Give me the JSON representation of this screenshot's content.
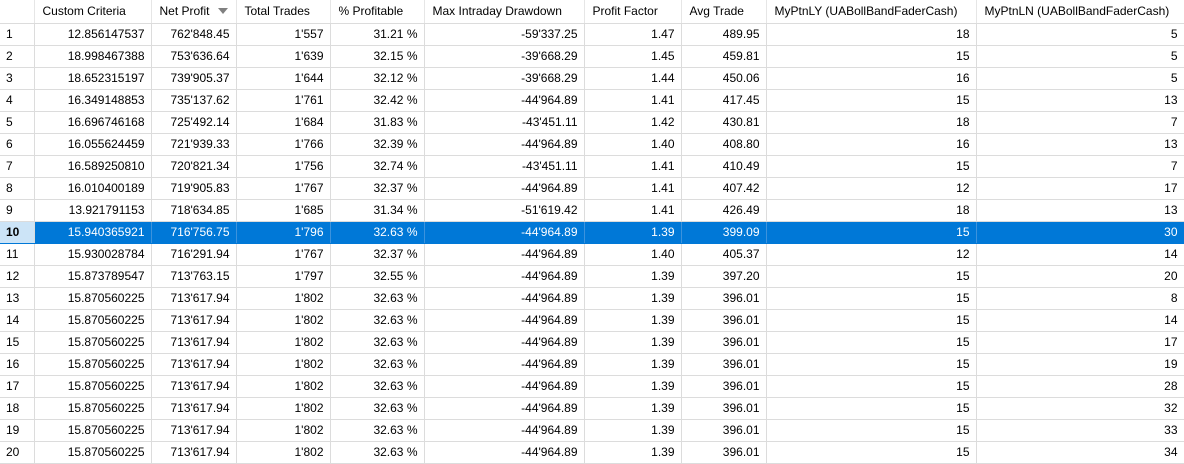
{
  "columns": [
    {
      "key": "idx",
      "label": ""
    },
    {
      "key": "custom",
      "label": "Custom Criteria"
    },
    {
      "key": "net",
      "label": "Net Profit"
    },
    {
      "key": "trades",
      "label": "Total Trades"
    },
    {
      "key": "pct",
      "label": "% Profitable"
    },
    {
      "key": "dd",
      "label": "Max Intraday Drawdown"
    },
    {
      "key": "pf",
      "label": "Profit Factor"
    },
    {
      "key": "avg",
      "label": "Avg Trade"
    },
    {
      "key": "ly",
      "label": "MyPtnLY (UABollBandFaderCash)"
    },
    {
      "key": "ln",
      "label": "MyPtnLN (UABollBandFaderCash)"
    }
  ],
  "sort": {
    "column": "net",
    "direction": "desc",
    "icon": "sort-descending-icon"
  },
  "selected_row": 10,
  "colors": {
    "selection": "#0078d7",
    "selection_index": "#cce4f7",
    "grid_line": "#dcdcdc"
  },
  "rows": [
    [
      "1",
      "12.856147537",
      "762'848.45",
      "1'557",
      "31.21 %",
      "-59'337.25",
      "1.47",
      "489.95",
      "18",
      "5"
    ],
    [
      "2",
      "18.998467388",
      "753'636.64",
      "1'639",
      "32.15 %",
      "-39'668.29",
      "1.45",
      "459.81",
      "15",
      "5"
    ],
    [
      "3",
      "18.652315197",
      "739'905.37",
      "1'644",
      "32.12 %",
      "-39'668.29",
      "1.44",
      "450.06",
      "16",
      "5"
    ],
    [
      "4",
      "16.349148853",
      "735'137.62",
      "1'761",
      "32.42 %",
      "-44'964.89",
      "1.41",
      "417.45",
      "15",
      "13"
    ],
    [
      "5",
      "16.696746168",
      "725'492.14",
      "1'684",
      "31.83 %",
      "-43'451.11",
      "1.42",
      "430.81",
      "18",
      "7"
    ],
    [
      "6",
      "16.055624459",
      "721'939.33",
      "1'766",
      "32.39 %",
      "-44'964.89",
      "1.40",
      "408.80",
      "16",
      "13"
    ],
    [
      "7",
      "16.589250810",
      "720'821.34",
      "1'756",
      "32.74 %",
      "-43'451.11",
      "1.41",
      "410.49",
      "15",
      "7"
    ],
    [
      "8",
      "16.010400189",
      "719'905.83",
      "1'767",
      "32.37 %",
      "-44'964.89",
      "1.41",
      "407.42",
      "12",
      "17"
    ],
    [
      "9",
      "13.921791153",
      "718'634.85",
      "1'685",
      "31.34 %",
      "-51'619.42",
      "1.41",
      "426.49",
      "18",
      "13"
    ],
    [
      "10",
      "15.940365921",
      "716'756.75",
      "1'796",
      "32.63 %",
      "-44'964.89",
      "1.39",
      "399.09",
      "15",
      "30"
    ],
    [
      "11",
      "15.930028784",
      "716'291.94",
      "1'767",
      "32.37 %",
      "-44'964.89",
      "1.40",
      "405.37",
      "12",
      "14"
    ],
    [
      "12",
      "15.873789547",
      "713'763.15",
      "1'797",
      "32.55 %",
      "-44'964.89",
      "1.39",
      "397.20",
      "15",
      "20"
    ],
    [
      "13",
      "15.870560225",
      "713'617.94",
      "1'802",
      "32.63 %",
      "-44'964.89",
      "1.39",
      "396.01",
      "15",
      "8"
    ],
    [
      "14",
      "15.870560225",
      "713'617.94",
      "1'802",
      "32.63 %",
      "-44'964.89",
      "1.39",
      "396.01",
      "15",
      "14"
    ],
    [
      "15",
      "15.870560225",
      "713'617.94",
      "1'802",
      "32.63 %",
      "-44'964.89",
      "1.39",
      "396.01",
      "15",
      "17"
    ],
    [
      "16",
      "15.870560225",
      "713'617.94",
      "1'802",
      "32.63 %",
      "-44'964.89",
      "1.39",
      "396.01",
      "15",
      "19"
    ],
    [
      "17",
      "15.870560225",
      "713'617.94",
      "1'802",
      "32.63 %",
      "-44'964.89",
      "1.39",
      "396.01",
      "15",
      "28"
    ],
    [
      "18",
      "15.870560225",
      "713'617.94",
      "1'802",
      "32.63 %",
      "-44'964.89",
      "1.39",
      "396.01",
      "15",
      "32"
    ],
    [
      "19",
      "15.870560225",
      "713'617.94",
      "1'802",
      "32.63 %",
      "-44'964.89",
      "1.39",
      "396.01",
      "15",
      "33"
    ],
    [
      "20",
      "15.870560225",
      "713'617.94",
      "1'802",
      "32.63 %",
      "-44'964.89",
      "1.39",
      "396.01",
      "15",
      "34"
    ]
  ]
}
